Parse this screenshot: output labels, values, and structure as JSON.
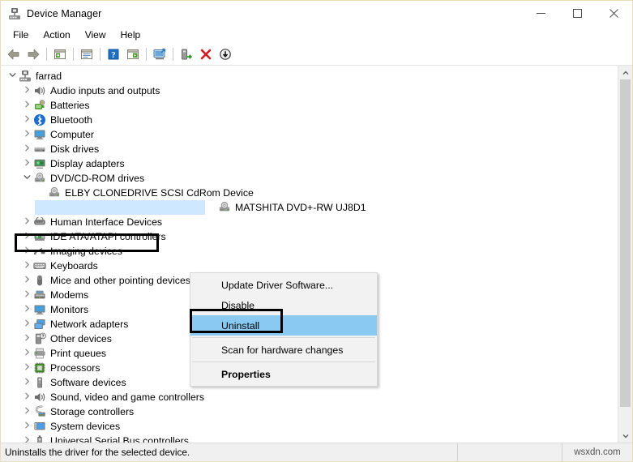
{
  "window": {
    "title": "Device Manager",
    "icon": "device-manager-icon",
    "controls": {
      "minimize": "—",
      "maximize": "□",
      "close": "✕"
    }
  },
  "menubar": {
    "items": [
      {
        "label": "File"
      },
      {
        "label": "Action"
      },
      {
        "label": "View"
      },
      {
        "label": "Help"
      }
    ]
  },
  "toolbar": {
    "buttons": [
      {
        "name": "back-icon"
      },
      {
        "name": "forward-icon"
      },
      {
        "name": "separator"
      },
      {
        "name": "show-hide-console-tree-icon"
      },
      {
        "name": "separator"
      },
      {
        "name": "properties-icon"
      },
      {
        "name": "separator"
      },
      {
        "name": "help-icon"
      },
      {
        "name": "view-devices-icon"
      },
      {
        "name": "separator"
      },
      {
        "name": "update-driver-icon"
      },
      {
        "name": "separator"
      },
      {
        "name": "enable-device-icon"
      },
      {
        "name": "uninstall-device-icon"
      },
      {
        "name": "scan-hardware-changes-icon"
      }
    ]
  },
  "tree": {
    "nodes": [
      {
        "label": "farrad",
        "indent": 0,
        "chevron": "expanded",
        "icon": "computer-root-icon",
        "selected": false
      },
      {
        "label": "Audio inputs and outputs",
        "indent": 1,
        "chevron": "collapsed",
        "icon": "speaker-icon",
        "selected": false
      },
      {
        "label": "Batteries",
        "indent": 1,
        "chevron": "collapsed",
        "icon": "battery-icon",
        "selected": false
      },
      {
        "label": "Bluetooth",
        "indent": 1,
        "chevron": "collapsed",
        "icon": "bluetooth-icon",
        "selected": false
      },
      {
        "label": "Computer",
        "indent": 1,
        "chevron": "collapsed",
        "icon": "monitor-icon",
        "selected": false
      },
      {
        "label": "Disk drives",
        "indent": 1,
        "chevron": "collapsed",
        "icon": "disk-drive-icon",
        "selected": false
      },
      {
        "label": "Display adapters",
        "indent": 1,
        "chevron": "collapsed",
        "icon": "display-adapter-icon",
        "selected": false
      },
      {
        "label": "DVD/CD-ROM drives",
        "indent": 1,
        "chevron": "expanded",
        "icon": "optical-drive-icon",
        "selected": false
      },
      {
        "label": "ELBY CLONEDRIVE SCSI CdRom Device",
        "indent": 2,
        "chevron": "none",
        "icon": "optical-drive-icon",
        "selected": false
      },
      {
        "label": "MATSHITA DVD+-RW UJ8D1",
        "indent": 2,
        "chevron": "none",
        "icon": "optical-drive-icon",
        "selected": true
      },
      {
        "label": "Human Interface Devices",
        "indent": 1,
        "chevron": "collapsed",
        "icon": "hid-icon",
        "selected": false
      },
      {
        "label": "IDE ATA/ATAPI controllers",
        "indent": 1,
        "chevron": "collapsed",
        "icon": "ide-controller-icon",
        "selected": false
      },
      {
        "label": "Imaging devices",
        "indent": 1,
        "chevron": "collapsed",
        "icon": "camera-icon",
        "selected": false
      },
      {
        "label": "Keyboards",
        "indent": 1,
        "chevron": "collapsed",
        "icon": "keyboard-icon",
        "selected": false
      },
      {
        "label": "Mice and other pointing devices",
        "indent": 1,
        "chevron": "collapsed",
        "icon": "mouse-icon",
        "selected": false
      },
      {
        "label": "Modems",
        "indent": 1,
        "chevron": "collapsed",
        "icon": "modem-icon",
        "selected": false
      },
      {
        "label": "Monitors",
        "indent": 1,
        "chevron": "collapsed",
        "icon": "monitor-icon",
        "selected": false
      },
      {
        "label": "Network adapters",
        "indent": 1,
        "chevron": "collapsed",
        "icon": "network-adapter-icon",
        "selected": false
      },
      {
        "label": "Other devices",
        "indent": 1,
        "chevron": "collapsed",
        "icon": "unknown-device-icon",
        "selected": false
      },
      {
        "label": "Print queues",
        "indent": 1,
        "chevron": "collapsed",
        "icon": "printer-icon",
        "selected": false
      },
      {
        "label": "Processors",
        "indent": 1,
        "chevron": "collapsed",
        "icon": "processor-icon",
        "selected": false
      },
      {
        "label": "Software devices",
        "indent": 1,
        "chevron": "collapsed",
        "icon": "software-device-icon",
        "selected": false
      },
      {
        "label": "Sound, video and game controllers",
        "indent": 1,
        "chevron": "collapsed",
        "icon": "speaker-icon",
        "selected": false
      },
      {
        "label": "Storage controllers",
        "indent": 1,
        "chevron": "collapsed",
        "icon": "storage-controller-icon",
        "selected": false
      },
      {
        "label": "System devices",
        "indent": 1,
        "chevron": "collapsed",
        "icon": "system-device-icon",
        "selected": false
      },
      {
        "label": "Universal Serial Bus controllers",
        "indent": 1,
        "chevron": "collapsed",
        "icon": "usb-icon",
        "selected": false
      }
    ]
  },
  "context_menu": {
    "items": [
      {
        "label": "Update Driver Software...",
        "highlighted": false,
        "bold": false
      },
      {
        "label": "Disable",
        "highlighted": false,
        "bold": false
      },
      {
        "label": "Uninstall",
        "highlighted": true,
        "bold": false
      },
      {
        "label": "Scan for hardware changes",
        "highlighted": false,
        "bold": false
      },
      {
        "label": "Properties",
        "highlighted": false,
        "bold": true
      }
    ]
  },
  "statusbar": {
    "message": "Uninstalls the driver for the selected device.",
    "watermark": "wsxdn.com"
  },
  "colors": {
    "selection": "#cde8ff",
    "menu_highlight": "#8ac9f2",
    "annotation": "#000000",
    "window_border": "#e8dfb8"
  }
}
